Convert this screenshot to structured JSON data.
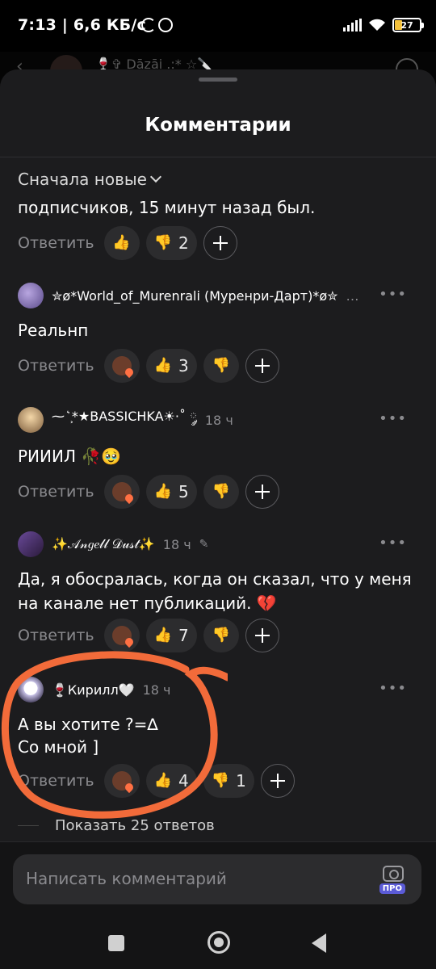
{
  "status_bar": {
    "time": "7:13 | 6,6 КБ/с",
    "battery": "27"
  },
  "background_header": {
    "title": "🍷✞ Dāzāi .:* ☆🔪"
  },
  "sheet": {
    "title": "Комментарии",
    "sort_label": "Сначала новые"
  },
  "reply_label": "Ответить",
  "comments": [
    {
      "text": "подписчиков, 15 минут назад был.",
      "reactions": {
        "likes": "",
        "dislikes": "2"
      }
    },
    {
      "author": "✮ø*World_of_Murenrali (Муренри-Дарт)*ø✮",
      "time": "",
      "text": "Реальнп",
      "reactions": {
        "likes": "3",
        "dislikes": ""
      }
    },
    {
      "author": "⁓ ͛ ͕*★BASSICHKA☀︎·˚ ༘",
      "time": "18 ч",
      "text": "РИИИЛ 🥀🥹",
      "reactions": {
        "likes": "5",
        "dislikes": ""
      }
    },
    {
      "author": "✨𝒜𝓃𝑔𝑒𝓁𝓁 𝒟𝓊𝓈𝓉✨",
      "time": "18 ч",
      "text": "Да, я обосралась, когда он сказал, что у меня на канале нет публикаций. 💔",
      "reactions": {
        "likes": "7",
        "dislikes": ""
      }
    },
    {
      "author": "🍷Кирилл🤍",
      "time": "18 ч",
      "text_line1": "А вы хотите ?=∆",
      "text_line2": "Со мной ]",
      "reactions": {
        "likes": "4",
        "dislikes": "1"
      }
    }
  ],
  "show_replies": "Показать 25 ответов",
  "composer": {
    "placeholder": "Написать комментарий",
    "pro_badge": "ПРО"
  },
  "colors": {
    "sheet_bg": "#1c1c1e",
    "pill_bg": "#2c2c2e",
    "annotation": "#f26b3a"
  }
}
